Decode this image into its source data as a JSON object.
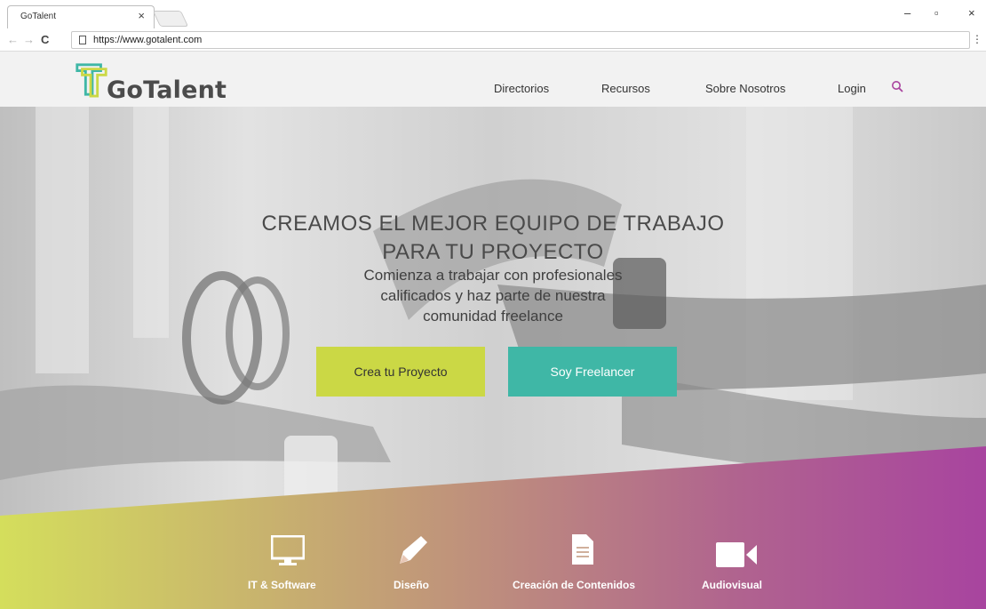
{
  "browser": {
    "tab_title": "GoTalent",
    "tab_close": "×",
    "url": "https://www.gotalent.com",
    "nav_back": "←",
    "nav_forward": "→",
    "nav_reload": "C",
    "menu": "⋮",
    "minimize": "–",
    "restore": "▫",
    "close": "×"
  },
  "header": {
    "logo_text": "GoTalent",
    "nav": [
      {
        "label": "Directorios"
      },
      {
        "label": "Recursos"
      },
      {
        "label": "Sobre Nosotros"
      },
      {
        "label": "Login"
      }
    ],
    "search_icon": "search-icon"
  },
  "hero": {
    "title_line1": "CREAMOS EL MEJOR EQUIPO DE TRABAJO",
    "title_line2": "PARA TU PROYECTO",
    "subtitle_line1": "Comienza a trabajar  con profesionales",
    "subtitle_line2": "calificados y haz parte de nuestra",
    "subtitle_line3": "comunidad freelance",
    "btn_project": "Crea tu Proyecto",
    "btn_freelancer": "Soy Freelancer"
  },
  "categories": [
    {
      "label": "IT & Software",
      "icon": "monitor-icon"
    },
    {
      "label": "Diseño",
      "icon": "pencil-icon"
    },
    {
      "label": "Creación de Contenidos",
      "icon": "document-icon"
    },
    {
      "label": "Audiovisual",
      "icon": "video-camera-icon"
    }
  ],
  "colors": {
    "accent_green": "#cbd845",
    "accent_teal": "#3fb7a6",
    "accent_magenta": "#a9449f",
    "search_icon": "#a9449f"
  }
}
